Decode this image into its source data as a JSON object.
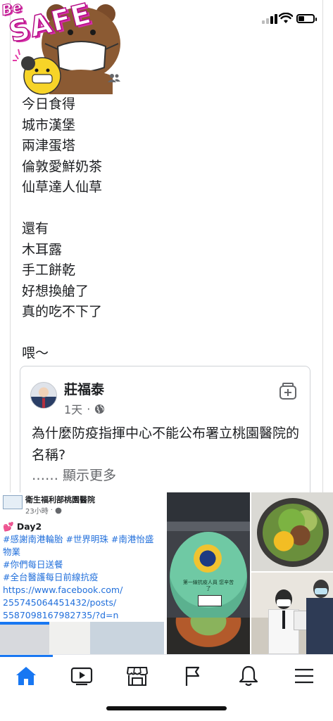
{
  "sticker": {
    "badge_small": "Be",
    "badge_large": "SAFE"
  },
  "post": {
    "text": "今日食得\n城市漢堡\n兩津蛋塔\n倫敦愛鮮奶茶\n仙草達人仙草\n\n還有\n木耳露\n手工餅乾\n好想換艙了\n真的吃不下了\n\n喂～"
  },
  "comment": {
    "author": "莊福泰",
    "time": "1天",
    "separator": "·",
    "text": "為什麼防疫指揮中心不能公布署立桃園醫院的名稱?",
    "see_more": "…… 顯示更多"
  },
  "shared_post": {
    "page_name": "衛生福利部桃園醫院",
    "time": "23小時",
    "separator": "·",
    "lines": [
      {
        "text": "💕 Day2",
        "style": "title"
      },
      {
        "text": "#感謝南港輪胎 #世界明珠 #南港怡盛",
        "style": "hash"
      },
      {
        "text": "物業",
        "style": "hash"
      },
      {
        "text": "#你們每日送餐",
        "style": "hash"
      },
      {
        "text": "#全台醫護每日前線抗疫",
        "style": "hash"
      },
      {
        "text": "https://www.facebook.com/",
        "style": "hash"
      },
      {
        "text": "255745064451432/posts/",
        "style": "hash"
      },
      {
        "text": "5587098167982735/?d=n",
        "style": "hash"
      }
    ]
  },
  "bowl_photo": {
    "lid_text": "第一線抗疫人員 您辛苦了"
  },
  "nav": {
    "tabs": [
      "home-icon",
      "video-icon",
      "marketplace-icon",
      "pages-flag-icon",
      "notifications-bell-icon",
      "menu-icon"
    ],
    "active_tab": "home-icon",
    "accent": "#1877f2"
  }
}
